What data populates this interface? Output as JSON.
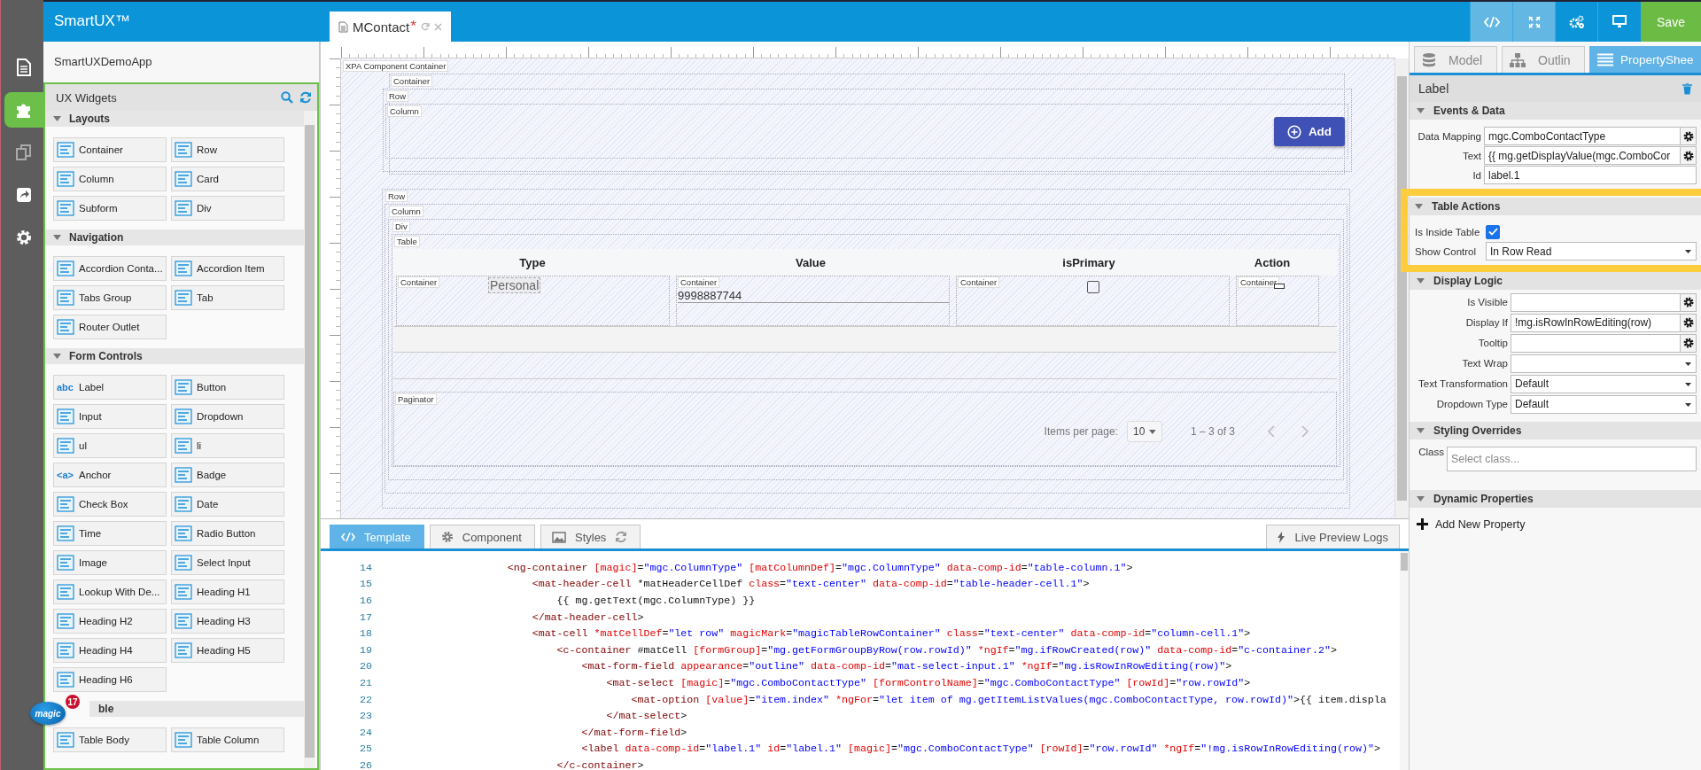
{
  "sidebar": {
    "items": [
      {
        "kind": "document",
        "selected": false
      },
      {
        "kind": "puzzle",
        "selected": true
      },
      {
        "kind": "copy",
        "selected": false
      },
      {
        "kind": "share",
        "selected": false
      },
      {
        "kind": "gear",
        "selected": false
      }
    ]
  },
  "app": {
    "title": "SmartUX™",
    "project": "SmartUXDemoApp"
  },
  "editor_tab": {
    "title": "MContact",
    "dirty_mark": "*"
  },
  "toolbar": [
    {
      "kind": "code",
      "selected": true
    },
    {
      "kind": "expand",
      "selected": true
    },
    {
      "kind": "gears",
      "selected": false
    },
    {
      "kind": "monitor",
      "selected": false
    }
  ],
  "save_button": "Save",
  "widgets": {
    "title": "UX Widgets",
    "groups": [
      {
        "title": "Layouts",
        "expanded": true,
        "items": [
          {
            "label": "Container"
          },
          {
            "label": "Row"
          },
          {
            "label": "Column"
          },
          {
            "label": "Card"
          },
          {
            "label": "Subform"
          },
          {
            "label": "Div"
          }
        ]
      },
      {
        "title": "Navigation",
        "expanded": true,
        "items": [
          {
            "label": "Accordion Conta..."
          },
          {
            "label": "Accordion Item"
          },
          {
            "label": "Tabs Group"
          },
          {
            "label": "Tab"
          },
          {
            "label": "Router Outlet"
          }
        ]
      },
      {
        "title": "Form Controls",
        "expanded": true,
        "items": [
          {
            "label": "Label",
            "glyph": "abc"
          },
          {
            "label": "Button"
          },
          {
            "label": "Input"
          },
          {
            "label": "Dropdown"
          },
          {
            "label": "ul"
          },
          {
            "label": "li"
          },
          {
            "label": "Anchor",
            "glyph": "<a>"
          },
          {
            "label": "Badge"
          },
          {
            "label": "Check Box"
          },
          {
            "label": "Date"
          },
          {
            "label": "Time"
          },
          {
            "label": "Radio Button"
          },
          {
            "label": "Image"
          },
          {
            "label": "Select Input"
          },
          {
            "label": "Lookup With De..."
          },
          {
            "label": "Heading H1"
          },
          {
            "label": "Heading H2"
          },
          {
            "label": "Heading H3"
          },
          {
            "label": "Heading H4"
          },
          {
            "label": "Heading H5"
          },
          {
            "label": "Heading H6"
          }
        ]
      },
      {
        "title": "ble",
        "items": [
          {
            "label": "Table Body"
          },
          {
            "label": "Table Column"
          }
        ]
      }
    ]
  },
  "logo": {
    "text": "magic",
    "badge": "17"
  },
  "canvas": {
    "root_label": "XPA Component Container",
    "top": {
      "container_label": "Container",
      "row_label": "Row",
      "column_label": "Column",
      "button": "Add"
    },
    "table_section": {
      "row_label": "Row",
      "column_label": "Column",
      "div_label": "Div",
      "table_label": "Table",
      "columns": [
        {
          "header": "Type",
          "cell_label": "Container",
          "kind": "select",
          "value": "Personal"
        },
        {
          "header": "Value",
          "cell_label": "Container",
          "kind": "input",
          "value": "9998887744"
        },
        {
          "header": "isPrimary",
          "cell_label": "Container",
          "kind": "checkbox",
          "checked": false
        },
        {
          "header": "Action",
          "cell_label": "Container",
          "kind": "action"
        }
      ],
      "paginator": {
        "label": "Paginator",
        "items_label": "Items per page:",
        "page_size": "10",
        "range": "1 – 3 of 3"
      }
    }
  },
  "bottom_tabs": [
    {
      "label": "Template",
      "kind": "code",
      "selected": true
    },
    {
      "label": "Component",
      "kind": "gear",
      "selected": false
    },
    {
      "label": "Styles",
      "kind": "image",
      "selected": false
    }
  ],
  "logs_button": "Live Preview Logs",
  "code_lines": [
    {
      "number": "14",
      "text": "                    <ng-container [magic]=\"mgc.ColumnType\" [matColumnDef]=\"mgc.ColumnType\" data-comp-id=\"table-column.1\">"
    },
    {
      "number": "15",
      "text": "                        <mat-header-cell *matHeaderCellDef class=\"text-center\" data-comp-id=\"table-header-cell.1\">"
    },
    {
      "number": "16",
      "text": "                            {{ mg.getText(mgc.ColumnType) }}"
    },
    {
      "number": "17",
      "text": "                        </mat-header-cell>"
    },
    {
      "number": "18",
      "text": "                        <mat-cell *matCellDef=\"let row\" magicMark=\"magicTableRowContainer\" class=\"text-center\" data-comp-id=\"column-cell.1\">"
    },
    {
      "number": "19",
      "text": "                            <c-container #matCell [formGroup]=\"mg.getFormGroupByRow(row.rowId)\" *ngIf=\"mg.ifRowCreated(row)\" data-comp-id=\"c-container.2\">"
    },
    {
      "number": "20",
      "text": "                                <mat-form-field appearance=\"outline\" data-comp-id=\"mat-select-input.1\" *ngIf=\"mg.isRowInRowEditing(row)\">"
    },
    {
      "number": "21",
      "text": "                                    <mat-select [magic]=\"mgc.ComboContactType\" [formControlName]=\"mgc.ComboContactType\" [rowId]=\"row.rowId\">"
    },
    {
      "number": "22",
      "text": "                                        <mat-option [value]=\"item.index\" *ngFor=\"let item of mg.getItemListValues(mgc.ComboContactType, row.rowId)\">{{ item.displa"
    },
    {
      "number": "23",
      "text": "                                    </mat-select>"
    },
    {
      "number": "24",
      "text": "                                </mat-form-field>"
    },
    {
      "number": "25",
      "text": "                                <label data-comp-id=\"label.1\" id=\"label.1\" [magic]=\"mgc.ComboContactType\" [rowId]=\"row.rowId\" *ngIf=\"!mg.isRowInRowEditing(row)\">"
    },
    {
      "number": "26",
      "text": "                            </c-container>"
    }
  ],
  "property_tabs": [
    {
      "label": "Model",
      "kind": "database",
      "selected": false
    },
    {
      "label": "Outlin",
      "kind": "tree",
      "selected": false
    },
    {
      "label": "PropertyShee",
      "kind": "list",
      "selected": true
    }
  ],
  "element_title": "Label",
  "sections": [
    {
      "title": "Events & Data",
      "expanded": true,
      "highlighted": false,
      "rows": [
        {
          "kind": "field-gear",
          "label": "Data Mapping",
          "value": "mgc.ComboContactType"
        },
        {
          "kind": "field-gear",
          "label": "Text",
          "value": "{{ mg.getDisplayValue(mgc.ComboCor"
        },
        {
          "kind": "field",
          "label": "Id",
          "value": "label.1"
        }
      ]
    },
    {
      "title": "Table Actions",
      "expanded": true,
      "highlighted": true,
      "rows": [
        {
          "kind": "checkbox",
          "label": "Is Inside Table",
          "checked": true
        },
        {
          "kind": "select",
          "label": "Show Control",
          "value": "In Row Read"
        }
      ]
    },
    {
      "title": "Display Logic",
      "expanded": true,
      "highlighted": false,
      "rows": [
        {
          "kind": "field-gear",
          "label": "Is Visible"
        },
        {
          "kind": "field-gear",
          "label": "Display If",
          "value": "!mg.isRowInRowEditing(row)"
        },
        {
          "kind": "field-gear",
          "label": "Tooltip"
        },
        {
          "kind": "select",
          "label": "Text Wrap"
        },
        {
          "kind": "select",
          "label": "Text Transformation",
          "value": "Default"
        },
        {
          "kind": "select",
          "label": "Dropdown Type",
          "value": "Default"
        }
      ]
    },
    {
      "title": "Styling Overrides",
      "expanded": true,
      "highlighted": false,
      "rows": [
        {
          "kind": "class",
          "label": "Class",
          "placeholder": "Select class..."
        }
      ]
    },
    {
      "title": "Dynamic Properties",
      "expanded": true,
      "highlighted": false,
      "rows": [
        {
          "kind": "add",
          "label": "Add New Property"
        }
      ]
    }
  ]
}
